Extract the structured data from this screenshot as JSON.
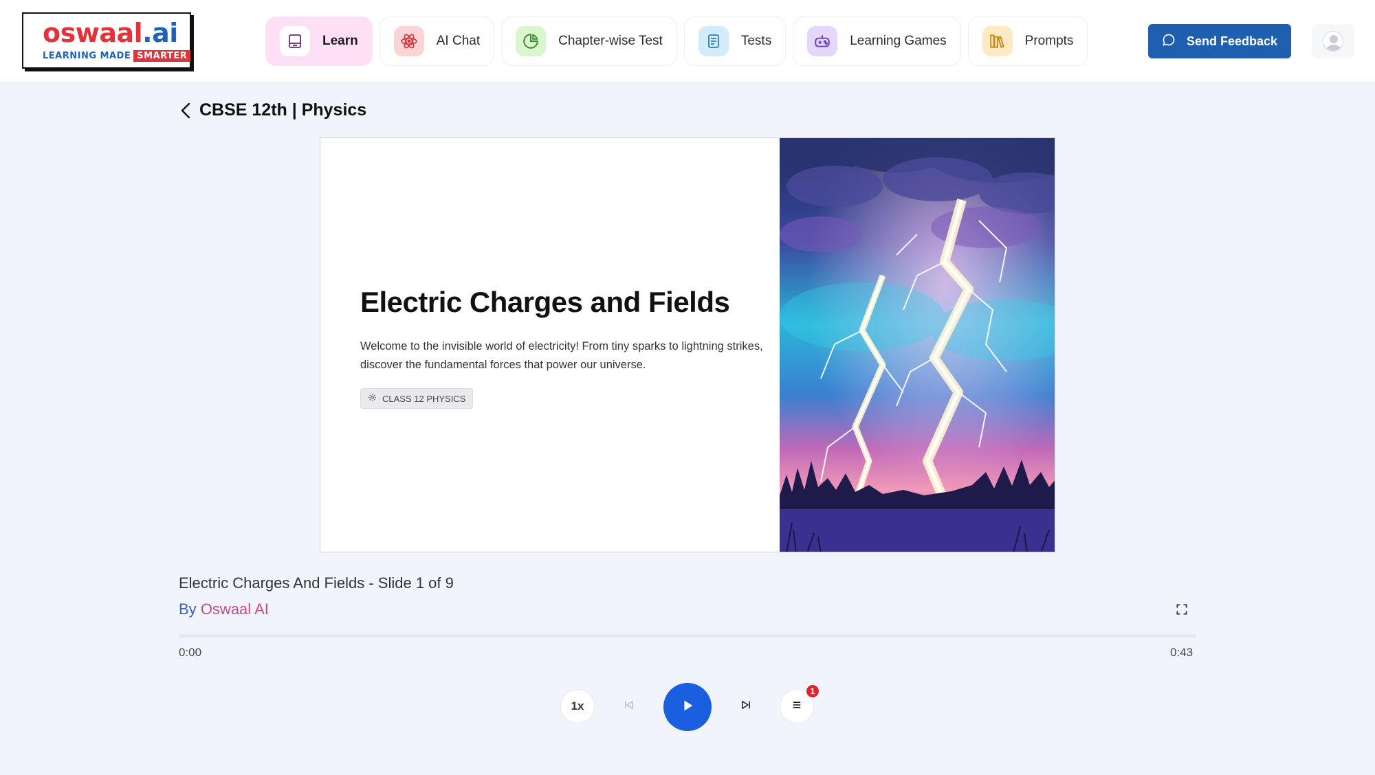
{
  "header": {
    "logo": {
      "main_part1": "oswaal",
      "main_part2": ".ai",
      "tagline": "LEARNING MADE",
      "tagline_highlight": "SMARTER"
    },
    "nav": [
      {
        "label": "Learn",
        "icon": "book-icon",
        "icon_bg": "#ffffff",
        "active": true
      },
      {
        "label": "AI Chat",
        "icon": "atom-icon",
        "icon_bg": "#fbd5d5",
        "active": false
      },
      {
        "label": "Chapter-wise Test",
        "icon": "chart-icon",
        "icon_bg": "#d9f6cf",
        "active": false
      },
      {
        "label": "Tests",
        "icon": "document-icon",
        "icon_bg": "#d3ecfb",
        "active": false
      },
      {
        "label": "Learning Games",
        "icon": "gamepad-icon",
        "icon_bg": "#e4d7fb",
        "active": false
      },
      {
        "label": "Prompts",
        "icon": "books-icon",
        "icon_bg": "#fde9c4",
        "active": false
      }
    ],
    "feedback_label": "Send Feedback"
  },
  "breadcrumb": {
    "title": "CBSE 12th | Physics"
  },
  "slide": {
    "title": "Electric Charges and Fields",
    "description": "Welcome to the invisible world of electricity! From tiny sparks to lightning strikes, discover the fundamental forces that power our universe.",
    "badge": "CLASS 12 PHYSICS"
  },
  "player": {
    "media_title": "Electric Charges And Fields - Slide 1 of 9",
    "author_prefix": "By",
    "author_name": "Oswaal AI",
    "current_time": "0:00",
    "total_time": "0:43",
    "progress": 0,
    "speed": "1x",
    "playlist_count": "1"
  },
  "colors": {
    "brand_blue": "#1e5fb0",
    "play_blue": "#1a5fe0",
    "learn_active": "#fde0f5",
    "badge_red": "#e0232e"
  }
}
